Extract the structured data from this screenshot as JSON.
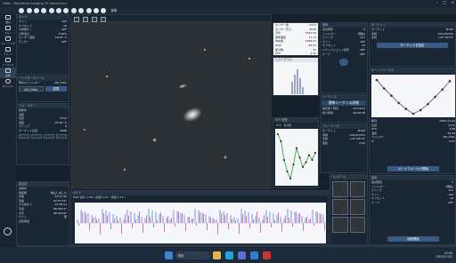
{
  "window": {
    "title": "NINA - Nighttime Imaging 'N' Astronomy",
    "controls": [
      "–",
      "□",
      "✕"
    ]
  },
  "toolbar": {
    "tab_label": "撮像"
  },
  "sidebar": {
    "items": [
      {
        "label": "機材",
        "icon": "telescope-icon"
      },
      {
        "label": "スカイ",
        "icon": "sky-icon"
      },
      {
        "label": "フレーミング",
        "icon": "framing-icon"
      },
      {
        "label": "フラット",
        "icon": "flat-icon"
      },
      {
        "label": "シーケンス",
        "icon": "sequence-icon"
      },
      {
        "label": "撮像",
        "icon": "camera-icon"
      },
      {
        "label": "オプション",
        "icon": "gear-icon"
      }
    ],
    "bottom_icon": "power-icon"
  },
  "camera_panel": {
    "title": "カメラ",
    "rows": [
      {
        "k": "ゲイン",
        "v": "100"
      },
      {
        "k": "オフセット",
        "v": "10"
      },
      {
        "k": "冷却器オン",
        "v": "OFF"
      },
      {
        "k": "冷却電力",
        "v": "0.00%"
      },
      {
        "k": "センサー温度",
        "v": "16.00 °C"
      },
      {
        "k": "ディザー",
        "v": "OFF"
      }
    ]
  },
  "filter_panel": {
    "title": "フィルターホイール",
    "current_label": "現在のフィルター",
    "current": "NO_Filter",
    "select": "NO_Filter",
    "button": "変更"
  },
  "focuser_panel": {
    "title": "フォーカサー",
    "rows": [
      {
        "k": "移動中",
        "v": ""
      },
      {
        "k": "温度",
        "v": ""
      },
      {
        "k": "位置",
        "v": "5772"
      },
      {
        "k": "温度",
        "v": "-55.00 °C"
      },
      {
        "k": "ステップ",
        "v": "0"
      },
      {
        "k": "ターゲット位置",
        "v": "5686"
      }
    ]
  },
  "mount_panel": {
    "title": "望遠鏡",
    "rows": [
      {
        "k": "追尾中",
        "v": ""
      },
      {
        "k": "恒星時",
        "v": "停止しました"
      },
      {
        "k": "赤経",
        "v": "12:27:42"
      },
      {
        "k": "赤緯",
        "v": "34°07'21\""
      },
      {
        "k": "子午線まで",
        "v": "07:56:11"
      },
      {
        "k": "高度",
        "v": "56°18'11\""
      },
      {
        "k": "方位",
        "v": "86°49'40\""
      },
      {
        "k": "サイド",
        "v": "東"
      },
      {
        "k": "反転時間",
        "v": ""
      }
    ]
  },
  "image_stats": {
    "rows": [
      {
        "k": "センサー幅",
        "v": "5472"
      },
      {
        "k": "センサー高さ",
        "v": "3648"
      },
      {
        "k": "平均",
        "v": "1462.56"
      },
      {
        "k": "標準偏差",
        "v": "71.13"
      },
      {
        "k": "中央値",
        "v": "1468.00"
      },
      {
        "k": "MAD",
        "v": "58.00"
      },
      {
        "k": "最小",
        "v": "142 / 4"
      },
      {
        "k": "最大",
        "v": "4095 / 3"
      },
      {
        "k": "星の数",
        "v": "36"
      },
      {
        "k": "HFR",
        "v": "3.35"
      }
    ]
  },
  "histogram": {
    "title": "ヒストグラム"
  },
  "hfr_graph": {
    "title": "HFR 履歴",
    "legend": [
      "HFR",
      "星の数"
    ],
    "points": [
      4.2,
      3.9,
      3.1,
      2.6,
      2.3,
      2.9,
      3.6,
      3.2,
      2.8,
      3.0,
      3.3,
      3.1,
      3.4
    ]
  },
  "autofocus": {
    "title": "オートフォーカス",
    "points": [
      4.8,
      4.1,
      3.5,
      2.9,
      2.4,
      2.0,
      2.3,
      2.8,
      3.4,
      4.0,
      4.7
    ],
    "rows": [
      {
        "k": "時刻",
        "v": "2025-11-22"
      },
      {
        "k": "位置",
        "v": "5772"
      },
      {
        "k": "HFR",
        "v": "2.08"
      },
      {
        "k": "温度",
        "v": "16.00"
      },
      {
        "k": "フィルター",
        "v": "NO_Filter"
      },
      {
        "k": "R²",
        "v": "0.97"
      }
    ],
    "button": "オートフォーカス開始"
  },
  "sequence": {
    "title": "シーケンス",
    "heading": "簡単シーケンス詳細",
    "rows": [
      {
        "k": "推定終了時刻",
        "v": "23:54:01"
      },
      {
        "k": "残り時間",
        "v": "00:45:18"
      }
    ]
  },
  "imaging": {
    "title": "撮像",
    "rows": [
      {
        "k": "露出時間",
        "v": "5"
      },
      {
        "k": "フィルター",
        "v": "(現在)"
      },
      {
        "k": "ビニング",
        "v": "1x1"
      },
      {
        "k": "ゲイン",
        "v": "100"
      },
      {
        "k": "オフセット",
        "v": "10"
      },
      {
        "k": "スナップショット保存",
        "v": "OFF"
      },
      {
        "k": "ループ",
        "v": "OFF"
      }
    ],
    "button": "撮影開始"
  },
  "framing": {
    "title": "フレーミング",
    "rows": [
      {
        "k": "ターゲット",
        "v": "M106"
      },
      {
        "k": "赤経",
        "v": "12h18m57s"
      },
      {
        "k": "赤緯",
        "v": "+47°18'14\""
      },
      {
        "k": "回転",
        "v": "0.00"
      }
    ]
  },
  "target": {
    "title": "ターゲット",
    "button": "ターゲットを設定"
  },
  "guider": {
    "title": "ガイド",
    "caption": "RMS 合計: 0.58\" (赤経 0.41\", 赤緯 0.41\")",
    "ra_color": "#4f7fe0",
    "dec_color": "#e04f8a"
  },
  "thumbnails": {
    "title": "サムネイル"
  },
  "statusbar": {
    "left": "撮像中",
    "right": "00:05"
  },
  "taskbar": {
    "search": "検索",
    "time": "22:49",
    "date": "2025/11/22",
    "icons": [
      "windows-icon",
      "search-icon",
      "files-icon",
      "edge-icon",
      "store-icon",
      "mail-icon",
      "nina-icon"
    ]
  }
}
